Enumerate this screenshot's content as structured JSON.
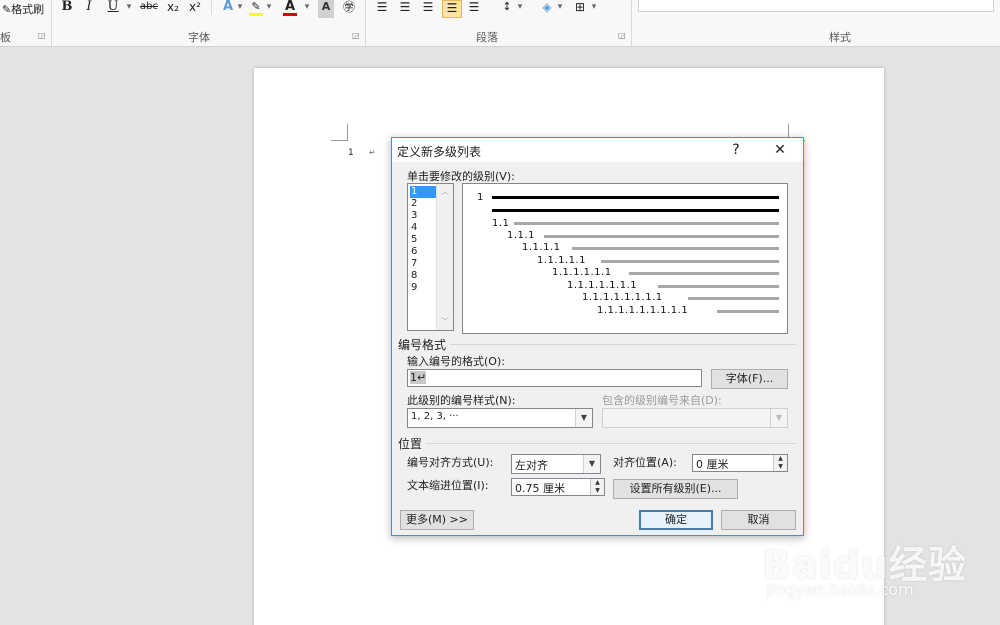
{
  "ribbon": {
    "format_painter_label": "格式刷",
    "clipboard_group_label": "板",
    "font_group_label": "字体",
    "paragraph_group_label": "段落",
    "styles_group_label": "样式",
    "font_buttons": [
      "B",
      "I",
      "U",
      "abc",
      "x₂",
      "x²"
    ],
    "highlight_color": "#ffff00",
    "font_color": "#e00000"
  },
  "document": {
    "first_line_number": "1",
    "paragraph_mark": "↵"
  },
  "dialog": {
    "title": "定义新多级列表",
    "help_button": "?",
    "close_button": "✕",
    "level_prompt": "单击要修改的级别(V):",
    "levels": [
      "1",
      "2",
      "3",
      "4",
      "5",
      "6",
      "7",
      "8",
      "9"
    ],
    "selected_level": "1",
    "preview_numbers": [
      "1",
      "1.1",
      "1.1.1",
      "1.1.1.1",
      "1.1.1.1.1",
      "1.1.1.1.1.1",
      "1.1.1.1.1.1.1",
      "1.1.1.1.1.1.1.1",
      "1.1.1.1.1.1.1.1.1"
    ],
    "numbering_format_section": "编号格式",
    "enter_format_label": "输入编号的格式(O):",
    "format_value": "1↵",
    "font_button": "字体(F)...",
    "number_style_label": "此级别的编号样式(N):",
    "number_style_value": "1, 2, 3, ···",
    "include_level_label": "包含的级别编号来自(D):",
    "position_section": "位置",
    "alignment_label": "编号对齐方式(U):",
    "alignment_value": "左对齐",
    "align_at_label": "对齐位置(A):",
    "align_at_value": "0 厘米",
    "text_indent_label": "文本缩进位置(I):",
    "text_indent_value": "0.75 厘米",
    "set_all_levels_button": "设置所有级别(E)...",
    "more_button": "更多(M) >>",
    "ok_button": "确定",
    "cancel_button": "取消"
  },
  "watermark": {
    "logo": "Baidu经验",
    "url": "jingyan.baidu.com"
  }
}
